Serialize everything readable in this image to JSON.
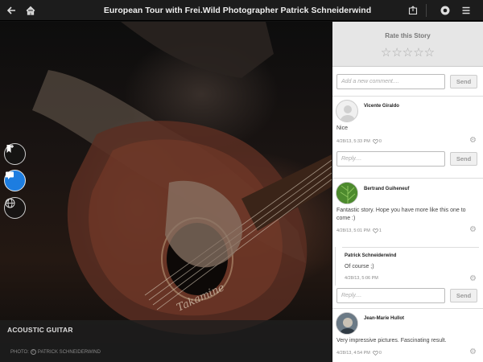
{
  "header": {
    "title": "European Tour with Frei.Wild  Photographer Patrick Schneiderwind",
    "icons": [
      "back-arrow-icon",
      "home-icon",
      "share-icon",
      "profile-icon",
      "menu-icon"
    ],
    "background_color": "#1c1c1c"
  },
  "photo": {
    "caption": "ACOUSTIC GUITAR",
    "credit_prefix": "PHOTO:",
    "credit_name": "PATRICK SCHNEIDERWIND",
    "side_buttons": [
      "bookmark-add-icon",
      "comments-icon",
      "globe-icon"
    ],
    "active_button_color": "#1d7de0"
  },
  "panel": {
    "rate_title": "Rate this Story",
    "stars": "☆☆☆☆☆",
    "rating": 0,
    "new_comment_placeholder": "Add a new comment....",
    "send_label": "Send",
    "reply_placeholder": "Reply....",
    "comments": [
      {
        "name": "Vicente Giraldo",
        "text": "Nice",
        "meta": "4/28/13, 5:33 PM",
        "likes": "0"
      },
      {
        "name": "Bertrand Guiheneuf",
        "text": "Fantastic story. Hope you have more like this one to come :)",
        "meta": "4/28/13, 5:01 PM",
        "likes": "1",
        "reply": {
          "name": "Patrick Schneiderwind",
          "text": "Of course ;)",
          "meta": "4/28/13, 5:06 PM"
        }
      },
      {
        "name": "Jean-Marie Hullot",
        "text": "Very impressive pictures. Fascinating result.",
        "meta": "4/28/13, 4:54 PM",
        "likes": "0"
      }
    ]
  }
}
